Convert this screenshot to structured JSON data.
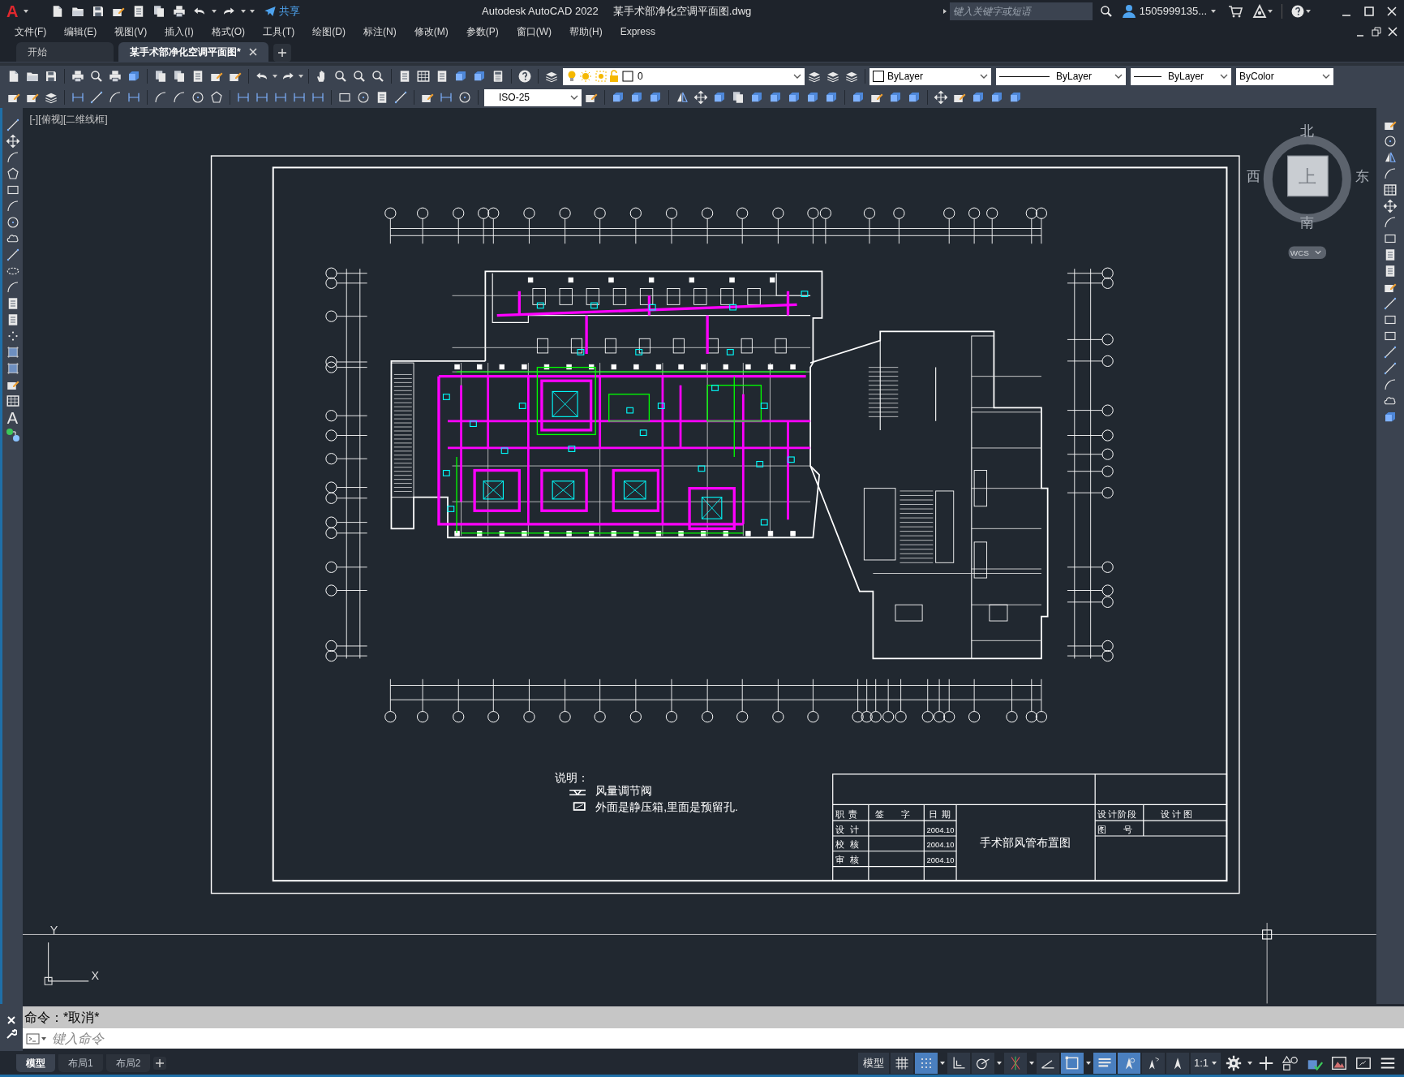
{
  "app": {
    "logo": "A",
    "product": "Autodesk AutoCAD 2022",
    "file": "某手术部净化空调平面图.dwg",
    "share": "共享"
  },
  "search": {
    "placeholder": "键入关键字或短语"
  },
  "user": {
    "name": "1505999135..."
  },
  "menu": [
    "文件(F)",
    "编辑(E)",
    "视图(V)",
    "插入(I)",
    "格式(O)",
    "工具(T)",
    "绘图(D)",
    "标注(N)",
    "修改(M)",
    "参数(P)",
    "窗口(W)",
    "帮助(H)",
    "Express"
  ],
  "tabs": [
    {
      "label": "开始",
      "selected": false
    },
    {
      "label": "某手术部净化空调平面图*",
      "selected": true
    }
  ],
  "properties": {
    "layer": "0",
    "color_setting": "ByLayer",
    "linetype": "ByLayer",
    "lineweight": "ByLayer",
    "plotstyle": "ByColor",
    "dimstyle": "ISO-25"
  },
  "draw_toolbar": {
    "text_tool": "A"
  },
  "viewport_label": "[-][俯视][二维线框]",
  "viewcube": {
    "north": "北",
    "south": "南",
    "east": "东",
    "west": "西",
    "face": "上",
    "ucs": "WCS"
  },
  "legend": {
    "title": "说明：",
    "items": [
      {
        "kind": "valve",
        "text": "风量调节阀"
      },
      {
        "kind": "box",
        "text": "外面是静压箱,里面是预留孔."
      }
    ]
  },
  "title_block": {
    "headers": [
      "职 责",
      "签 字",
      "日 期"
    ],
    "rows": [
      {
        "role": "设 计",
        "date": "2004.10"
      },
      {
        "role": "校 核",
        "date": "2004.10"
      },
      {
        "role": "审 核",
        "date": "2004.10"
      }
    ],
    "drawing_title": "手术部风管布置图",
    "stage_label": "设计阶段",
    "stage": "设计图",
    "number_label": "图 号"
  },
  "ucs_icon": {
    "x": "X",
    "y": "Y"
  },
  "command": {
    "history": "命令：*取消*",
    "placeholder": "键入命令"
  },
  "layout_tabs": [
    {
      "label": "模型",
      "selected": true
    },
    {
      "label": "布局1",
      "selected": false
    },
    {
      "label": "布局2",
      "selected": false
    }
  ],
  "status_bar": {
    "space": "模型",
    "scale": "1:1",
    "toggles": [
      {
        "kind": "grid",
        "on": false
      },
      {
        "kind": "snap",
        "on": true
      },
      {
        "kind": "ortho",
        "on": false
      },
      {
        "kind": "polar",
        "on": false
      },
      {
        "kind": "track",
        "on": false
      },
      {
        "kind": "angle",
        "on": false
      },
      {
        "kind": "osnap",
        "on": true
      },
      {
        "kind": "lineweight",
        "on": true
      },
      {
        "kind": "annovis",
        "on": true
      },
      {
        "kind": "autoscale",
        "on": false
      },
      {
        "kind": "annoscale",
        "on": false
      }
    ]
  }
}
